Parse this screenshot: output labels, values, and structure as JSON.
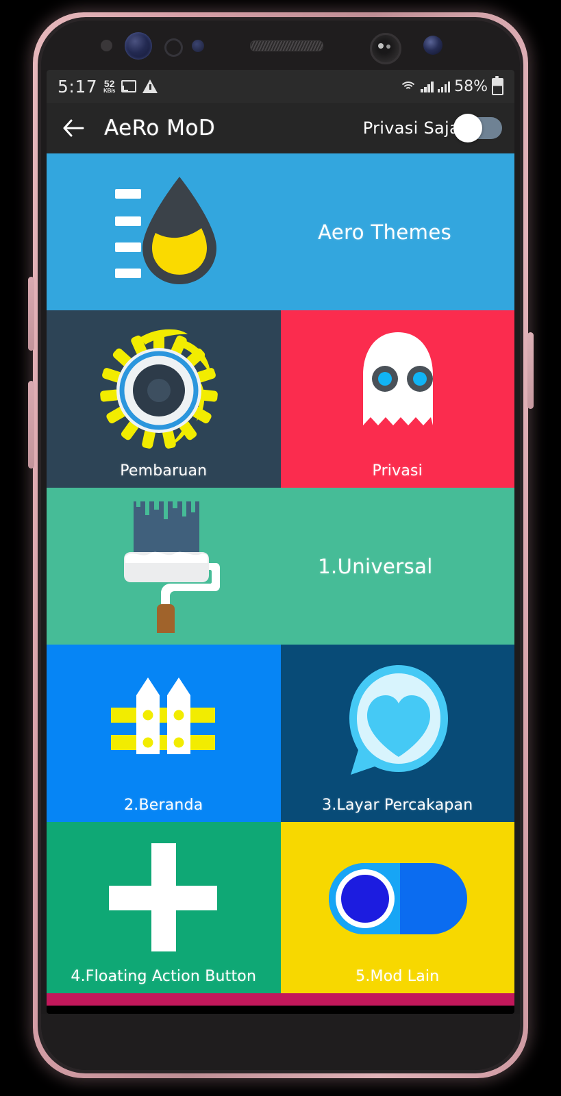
{
  "statusbar": {
    "time": "5:17",
    "data_rate_value": "52",
    "data_rate_unit": "KB/s",
    "battery_percent": "58%",
    "icons": [
      "screen-cast-icon",
      "warning-triangle-icon",
      "wifi-icon",
      "signal-sim1-icon",
      "signal-sim2-icon",
      "battery-icon"
    ]
  },
  "appbar": {
    "back_icon": "back-arrow-icon",
    "title": "AeRo MoD",
    "toggle_label": "Privasi Saja",
    "toggle_state": "off"
  },
  "tiles": [
    {
      "id": "aero-themes",
      "label": "Aero Themes",
      "layout": "wide",
      "bg": "#33a6de",
      "icon": "paint-droplet-icon",
      "label_position": "right"
    },
    {
      "id": "pembaruan",
      "label": "Pembaruan",
      "layout": "half",
      "bg": "#2d4456",
      "icon": "sun-eye-icon",
      "label_position": "bottom"
    },
    {
      "id": "privasi",
      "label": "Privasi",
      "layout": "half",
      "bg": "#fb2c4e",
      "icon": "ghost-icon",
      "label_position": "bottom"
    },
    {
      "id": "universal",
      "label": "1.Universal",
      "layout": "wide",
      "bg": "#46bc97",
      "icon": "paint-roller-icon",
      "label_position": "right"
    },
    {
      "id": "beranda",
      "label": "2.Beranda",
      "layout": "half",
      "bg": "#0685f5",
      "icon": "fence-icon",
      "label_position": "bottom"
    },
    {
      "id": "layar-percakapan",
      "label": "3.Layar Percakapan",
      "layout": "half",
      "bg": "#084b77",
      "icon": "chat-heart-icon",
      "label_position": "bottom"
    },
    {
      "id": "floating-action-button",
      "label": "4.Floating Action Button",
      "layout": "half",
      "bg": "#0fa875",
      "icon": "plus-icon",
      "label_position": "bottom"
    },
    {
      "id": "mod-lain",
      "label": "5.Mod Lain",
      "layout": "half",
      "bg": "#f7d800",
      "icon": "toggle-switch-icon",
      "label_position": "bottom"
    }
  ],
  "colors": {
    "accent_blue": "#33a6de",
    "red": "#fb2c4e",
    "green_teal": "#46bc97",
    "blue": "#0685f5",
    "navy": "#084b77",
    "green": "#0fa875",
    "yellow": "#f7d800",
    "dark_navy": "#2d4456",
    "bottom_strip": "#c2185b",
    "statusbar_bg": "#2b2b2b",
    "appbar_bg": "#262626",
    "phone_frame": "#d7a0a8"
  }
}
